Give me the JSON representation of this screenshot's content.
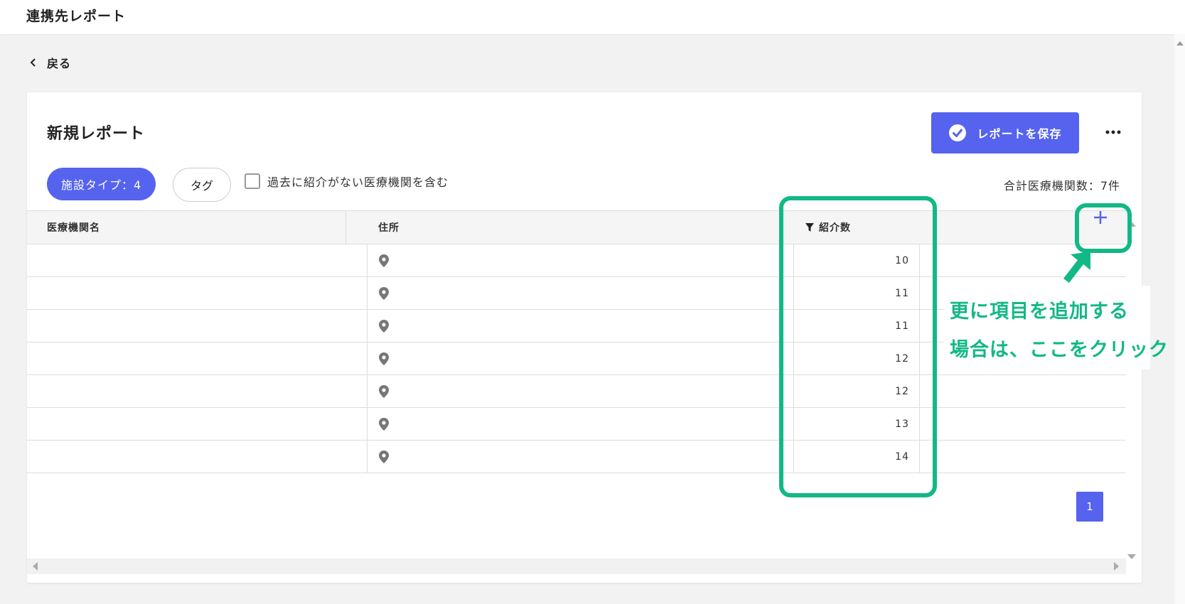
{
  "header": {
    "app_title": "連携先レポート"
  },
  "nav": {
    "back_label": "戻る"
  },
  "report": {
    "title": "新規レポート",
    "save_button_label": "レポートを保存",
    "more_icon": "more-horizontal-icon"
  },
  "filters": {
    "facility_type_chip": "施設タイプ：4",
    "tag_chip": "タグ",
    "include_no_referral_label": "過去に紹介がない医療機関を含む",
    "include_no_referral_checked": false,
    "total_label": "合計医療機関数：7件"
  },
  "table": {
    "columns": {
      "name": "医療機関名",
      "address": "住所",
      "referrals": "紹介数"
    },
    "rows": [
      {
        "name": "",
        "address": "",
        "referrals": "10"
      },
      {
        "name": "",
        "address": "",
        "referrals": "11"
      },
      {
        "name": "",
        "address": "",
        "referrals": "11"
      },
      {
        "name": "",
        "address": "",
        "referrals": "12"
      },
      {
        "name": "",
        "address": "",
        "referrals": "12"
      },
      {
        "name": "",
        "address": "",
        "referrals": "13"
      },
      {
        "name": "",
        "address": "",
        "referrals": "14"
      }
    ],
    "add_column_icon": "plus-icon"
  },
  "pagination": {
    "current_page": "1"
  },
  "annotation": {
    "line1": "更に項目を追加する",
    "line2": "場合は、ここをクリック",
    "color": "#12b886"
  },
  "colors": {
    "accent": "#5563ee",
    "annotation_green": "#12b886"
  }
}
